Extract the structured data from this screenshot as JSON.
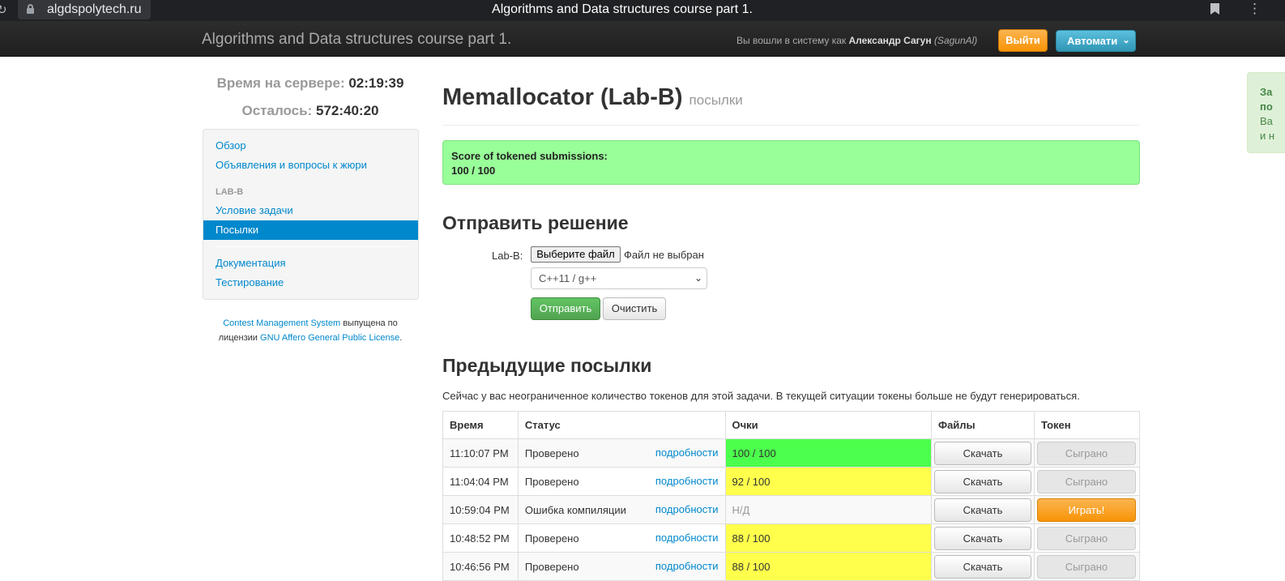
{
  "browser": {
    "url": "algdspolytech.ru",
    "title": "Algorithms and Data structures course part 1."
  },
  "navbar": {
    "brand": "Algorithms and Data structures course part 1.",
    "logged_prefix": "Вы вошли в систему как",
    "user_name": "Александр Сагун",
    "user_login": "(SagunAl)",
    "logout_label": "Выйти",
    "language_label": "Автомати"
  },
  "sidebar": {
    "server_time_label": "Время на сервере:",
    "server_time": "02:19:39",
    "remaining_label": "Осталось:",
    "remaining": "572:40:20",
    "items": [
      {
        "label": "Обзор"
      },
      {
        "label": "Объявления и вопросы к жюри"
      }
    ],
    "task_header": "LAB-B",
    "task_items": [
      {
        "label": "Условие задачи"
      },
      {
        "label": "Посылки"
      }
    ],
    "extra_items": [
      {
        "label": "Документация"
      },
      {
        "label": "Тестирование"
      }
    ],
    "license": {
      "cms_link": "Contest Management System",
      "text1": "выпущена по",
      "text2": "лицензии",
      "gnu_link": "GNU Affero General Public License",
      "dot": "."
    }
  },
  "main": {
    "title": "Memallocator (Lab-B)",
    "subtitle": "посылки",
    "score_label": "Score of tokened submissions:",
    "score_value": "100 / 100",
    "submit_title": "Отправить решение",
    "file_label": "Lab-B:",
    "file_button": "Выберите файл",
    "file_none": "Файл не выбран",
    "language_selected": "C++11 / g++",
    "send_button": "Отправить",
    "clear_button": "Очистить",
    "prev_title": "Предыдущие посылки",
    "tokens_note": "Сейчас у вас неограниченное количество токенов для этой задачи. В текущей ситуации токены больше не будут генерироваться."
  },
  "table": {
    "headers": [
      "Время",
      "Статус",
      "Очки",
      "Файлы",
      "Токен"
    ],
    "rows": [
      {
        "time": "11:10:07 PM",
        "status": "Проверено",
        "details": "подробности",
        "score": "100 / 100",
        "download": "Скачать",
        "token": "Сыграно"
      },
      {
        "time": "11:04:04 PM",
        "status": "Проверено",
        "details": "подробности",
        "score": "92 / 100",
        "download": "Скачать",
        "token": "Сыграно"
      },
      {
        "time": "10:59:04 PM",
        "status": "Ошибка компиляции",
        "details": "подробности",
        "score": "Н/Д",
        "download": "Скачать",
        "token": "Играть!"
      },
      {
        "time": "10:48:52 PM",
        "status": "Проверено",
        "details": "подробности",
        "score": "88 / 100",
        "download": "Скачать",
        "token": "Сыграно"
      },
      {
        "time": "10:46:56 PM",
        "status": "Проверено",
        "details": "подробности",
        "score": "88 / 100",
        "download": "Скачать",
        "token": "Сыграно"
      }
    ]
  },
  "notification": {
    "line1": "За",
    "line2": "по",
    "line3": "Ва",
    "line4": "и н"
  }
}
